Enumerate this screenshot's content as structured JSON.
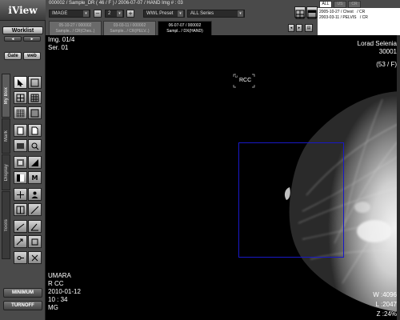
{
  "app": {
    "logo": "iView"
  },
  "sidebar": {
    "worklist_label": "Worklist",
    "gate_label": "Gate",
    "web_label": "web",
    "side_tabs": [
      "My Box",
      "Mark",
      "Display",
      "Tools"
    ],
    "minimum_label": "MINIMUM",
    "turnoff_label": "TURNOFF"
  },
  "topbar": {
    "info": "000002  /  Sample_DR  ( 46 / F )  /  2006-07-07  /  HAND     Img # : 03",
    "modality_select": "IMAGE",
    "layout_value": "2",
    "wwl_preset": "WWL Preset",
    "series_select": "ALL Series",
    "study_tabs": [
      {
        "line1": "05-10-27 / 000002",
        "line2": "Sample.. / CR(Ches..)",
        "active": false
      },
      {
        "line1": "03-03-11 / 000002",
        "line2": "Sample.. / CR(PELV..)",
        "active": false
      },
      {
        "line1": "06-07-07 / 000002",
        "line2": "Sampl.. / DX(HAND)",
        "active": true
      }
    ]
  },
  "history": {
    "tabs": [
      "ALL",
      "US",
      "CR"
    ],
    "rows": [
      {
        "date": "2005-10-27 / Chest",
        "mod": "/ CR"
      },
      {
        "date": "2003-03-11 / PELVIS",
        "mod": "/ CR"
      }
    ]
  },
  "overlay": {
    "top_left": [
      "Img. 01/4",
      "Ser. 01"
    ],
    "top_right": [
      "Lorad Selenia",
      "30001",
      "(53 / F)"
    ],
    "marker": "RCC",
    "marker_side": "U",
    "bottom_left": [
      "UMARA",
      "R CC",
      "2010-01-12",
      "10 : 34",
      "MG"
    ],
    "bottom_right": [
      "W :4096",
      "L :2047",
      "Z :24%"
    ]
  },
  "colors": {
    "roi": "#1818c8",
    "panel": "#4a4a4a"
  },
  "icons": [
    "select-icon",
    "grid-icon",
    "page-icon",
    "magnify-icon",
    "zoom-icon",
    "rotate-icon",
    "measure-icon",
    "annotation-icon"
  ]
}
